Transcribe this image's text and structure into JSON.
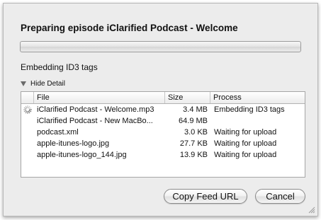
{
  "dialog": {
    "title": "Preparing episode iClarified Podcast - Welcome",
    "progress": 0.0,
    "status": "Embedding ID3 tags",
    "detail_toggle_label": "Hide Detail"
  },
  "table": {
    "columns": [
      "File",
      "Size",
      "Process"
    ],
    "rows": [
      {
        "busy": true,
        "file": "iClarified Podcast - Welcome.mp3",
        "size": "3.4 MB",
        "process": "Embedding ID3 tags"
      },
      {
        "busy": false,
        "file": "iClarified Podcast - New MacBo...",
        "size": "64.9 MB",
        "process": ""
      },
      {
        "busy": false,
        "file": "podcast.xml",
        "size": "3.0 KB",
        "process": "Waiting for upload"
      },
      {
        "busy": false,
        "file": "apple-itunes-logo.jpg",
        "size": "27.7 KB",
        "process": "Waiting for upload"
      },
      {
        "busy": false,
        "file": "apple-itunes-logo_144.jpg",
        "size": "13.9 KB",
        "process": "Waiting for upload"
      }
    ]
  },
  "buttons": {
    "copy_feed_url": "Copy Feed URL",
    "cancel": "Cancel"
  },
  "icons": {
    "spinner": "spinner-icon",
    "disclosure": "disclosure-triangle-icon",
    "resize": "resize-grip-icon"
  }
}
